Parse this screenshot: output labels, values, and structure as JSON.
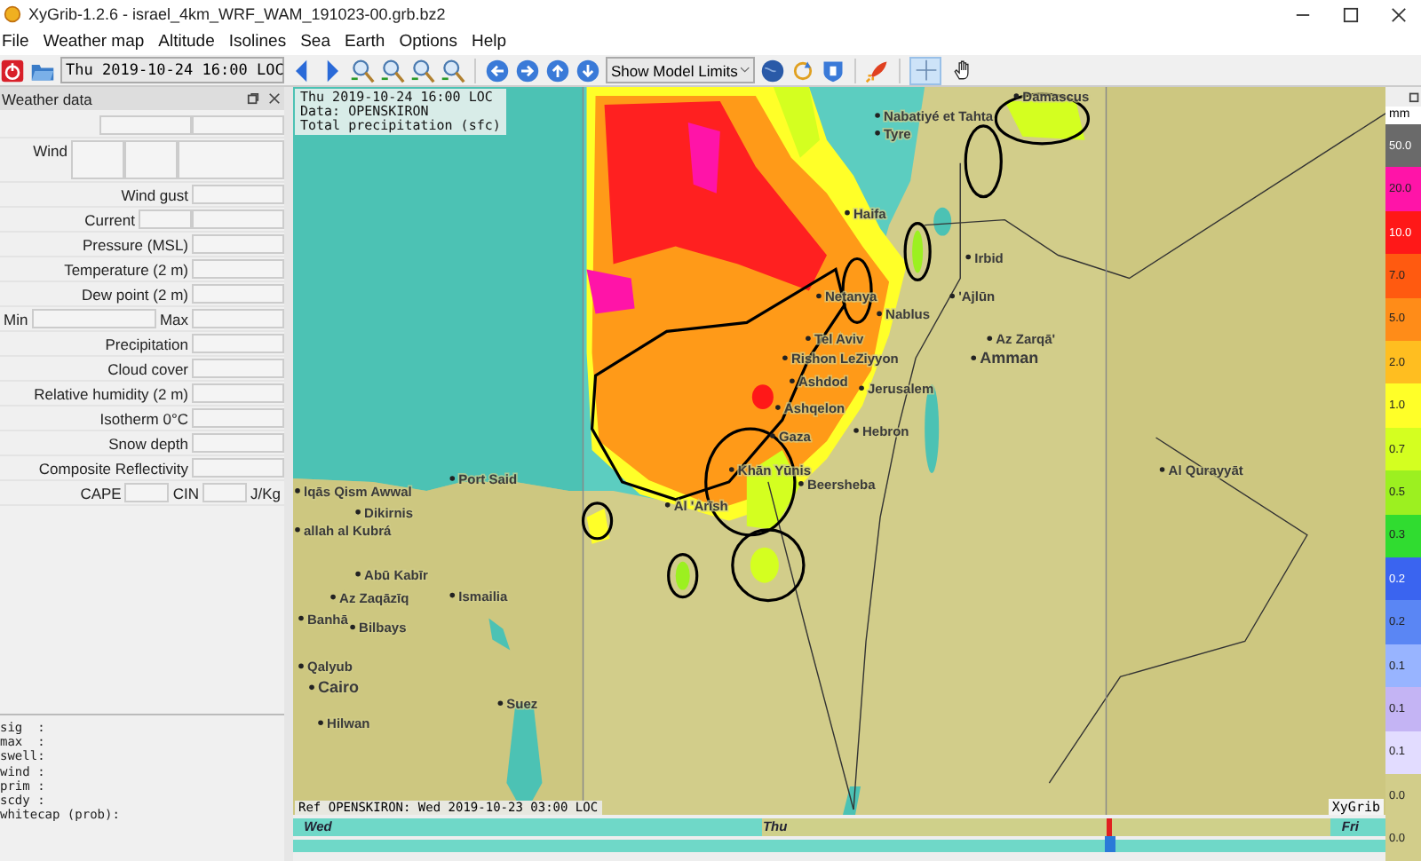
{
  "window": {
    "title": "XyGrib-1.2.6 - israel_4km_WRF_WAM_191023-00.grb.bz2"
  },
  "menu": [
    "File",
    "Weather map",
    "Altitude",
    "Isolines",
    "Sea",
    "Earth",
    "Options",
    "Help"
  ],
  "toolbar": {
    "date": "Thu 2019-10-24 16:00 LOC",
    "limits": "Show Model Limits",
    "modes": [
      {
        "kind": "crosshair",
        "selected": true
      },
      {
        "kind": "hand",
        "selected": false
      }
    ]
  },
  "weather_panel": {
    "title": "Weather data",
    "rows": [
      {
        "kind": "wind",
        "labels": [
          "Wind"
        ]
      },
      {
        "kind": "single",
        "labels": [
          "Wind gust"
        ]
      },
      {
        "kind": "double",
        "labels": [
          "Current"
        ]
      },
      {
        "kind": "single",
        "labels": [
          "Pressure (MSL)"
        ]
      },
      {
        "kind": "single",
        "labels": [
          "Temperature (2 m)"
        ]
      },
      {
        "kind": "single",
        "labels": [
          "Dew point (2 m)"
        ]
      },
      {
        "kind": "minmax",
        "labels": [
          "Min",
          "Max"
        ]
      },
      {
        "kind": "single",
        "labels": [
          "Precipitation"
        ]
      },
      {
        "kind": "single",
        "labels": [
          "Cloud cover"
        ]
      },
      {
        "kind": "single",
        "labels": [
          "Relative humidity (2 m)"
        ]
      },
      {
        "kind": "single",
        "labels": [
          "Isotherm 0°C"
        ]
      },
      {
        "kind": "single",
        "labels": [
          "Snow depth"
        ]
      },
      {
        "kind": "single",
        "labels": [
          "Composite Reflectivity"
        ]
      },
      {
        "kind": "cape",
        "labels": [
          "CAPE",
          "CIN",
          "J/Kg"
        ]
      }
    ],
    "wave_lines": [
      "sig  :",
      "max  :",
      "swell:",
      "wind :",
      "prim :",
      "scdy :",
      "whitecap (prob):"
    ]
  },
  "map": {
    "info": [
      "Thu 2019-10-24 16:00 LOC",
      "Data: OPENSKIRON",
      "Total precipitation (sfc)"
    ],
    "reference": "Ref OPENSKIRON: Wed 2019-10-23 03:00 LOC",
    "brand": "XyGrib",
    "cities": [
      "Damascus",
      "Nabatiyé et Tahta",
      "Tyre",
      "Haifa",
      "Irbid",
      "'Ajlūn",
      "Netanya",
      "Nablus",
      "Az Zarqā'",
      "Amman",
      "Tel Aviv",
      "Rishon LeZiyyon",
      "Ashdod",
      "Jerusalem",
      "Ashqelon",
      "Hebron",
      "Gaza",
      "Al Qurayyāt",
      "Khān Yūnis",
      "Beersheba",
      "Al 'Arīsh",
      "Port Said",
      "lqās Qism Awwal",
      "Dikirnis",
      "allah al Kubrá",
      "Abū Kabīr",
      "Az Zaqāzīq",
      "Ismailia",
      "Banhā",
      "Bilbays",
      "Qalyub",
      "Cairo",
      "Hilwan",
      "Suez"
    ]
  },
  "legend": {
    "unit": "mm",
    "steps": [
      {
        "label": "50.0",
        "color": "#6a6a6a"
      },
      {
        "label": "20.0",
        "color": "#ff14a8"
      },
      {
        "label": "10.0",
        "color": "#ff1818"
      },
      {
        "label": "7.0",
        "color": "#ff5a10"
      },
      {
        "label": "5.0",
        "color": "#ff8c18"
      },
      {
        "label": "2.0",
        "color": "#ffbe20"
      },
      {
        "label": "1.0",
        "color": "#ffff28"
      },
      {
        "label": "0.7",
        "color": "#d4ff20"
      },
      {
        "label": "0.5",
        "color": "#9cf020"
      },
      {
        "label": "0.3",
        "color": "#30dc30"
      },
      {
        "label": "0.2",
        "color": "#3a64f0"
      },
      {
        "label": "0.2",
        "color": "#5a86f4"
      },
      {
        "label": "0.1",
        "color": "#98b4ff"
      },
      {
        "label": "0.1",
        "color": "#c4b4f4"
      },
      {
        "label": "0.1",
        "color": "#e2dcff"
      },
      {
        "label": "0.0",
        "color": "#d2cd8a"
      },
      {
        "label": "0.0",
        "color": "#d2cd8a"
      }
    ]
  },
  "timeline": {
    "days": [
      "Wed",
      "Thu",
      "Fri"
    ],
    "level": 0.745
  }
}
